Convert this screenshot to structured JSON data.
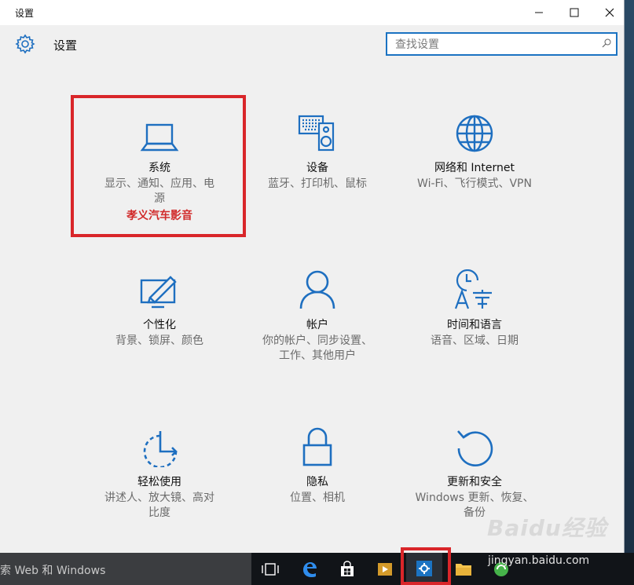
{
  "window": {
    "title": "设置",
    "header_title": "设置"
  },
  "search": {
    "placeholder": "查找设置"
  },
  "tiles": [
    {
      "name": "系统",
      "desc": "显示、通知、应用、电源",
      "watermark": "孝义汽车影音"
    },
    {
      "name": "设备",
      "desc": "蓝牙、打印机、鼠标"
    },
    {
      "name": "网络和 Internet",
      "desc": "Wi-Fi、飞行模式、VPN"
    },
    {
      "name": "个性化",
      "desc": "背景、锁屏、颜色"
    },
    {
      "name": "帐户",
      "desc": "你的帐户、同步设置、工作、其他用户"
    },
    {
      "name": "时间和语言",
      "desc": "语音、区域、日期"
    },
    {
      "name": "轻松使用",
      "desc": "讲述人、放大镜、高对比度"
    },
    {
      "name": "隐私",
      "desc": "位置、相机"
    },
    {
      "name": "更新和安全",
      "desc": "Windows 更新、恢复、备份"
    }
  ],
  "taskbar": {
    "search_text": "索 Web 和 Windows"
  },
  "watermark_site": {
    "brand": "Baidu经验",
    "url": "jingyan.baidu.com"
  },
  "colors": {
    "accent": "#1b73c2",
    "icon_blue": "#1e6fc0",
    "highlight_red": "#d9262a"
  }
}
